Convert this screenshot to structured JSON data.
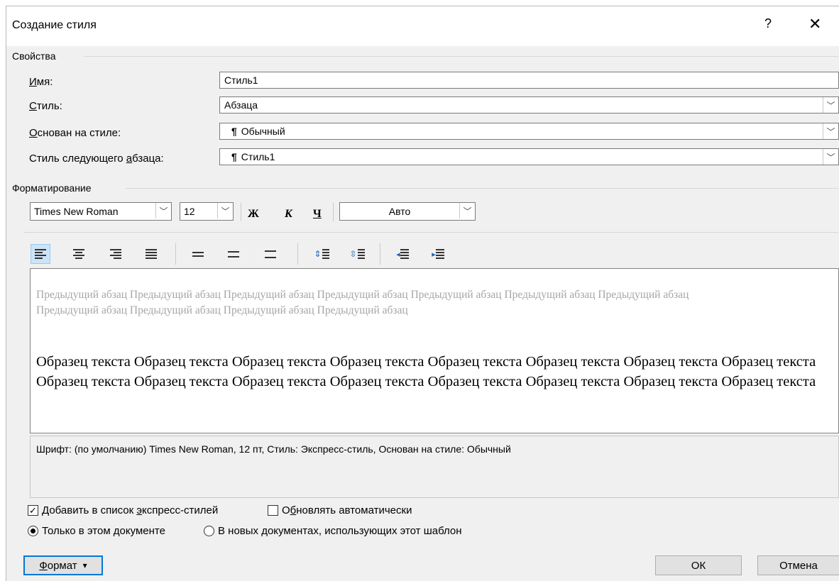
{
  "window": {
    "title": "Создание стиля",
    "help_label": "?",
    "close_label": "✕"
  },
  "properties": {
    "group_title": "Свойства",
    "name_label_u": "И",
    "name_label_rest": "мя:",
    "name_value": "Стиль1",
    "style_label_u": "С",
    "style_label_rest": "тиль:",
    "style_value": "Абзаца",
    "based_label_u": "О",
    "based_label_rest": "снован на стиле:",
    "based_value": "Обычный",
    "next_label_pre": "Стиль следующего ",
    "next_label_u": "а",
    "next_label_rest": "бзаца:",
    "next_value": "Стиль1"
  },
  "formatting": {
    "group_title": "Форматирование",
    "font_name": "Times New Roman",
    "font_size": "12",
    "bold_label": "Ж",
    "italic_label": "К",
    "underline_label": "Ч",
    "color_value": "Авто"
  },
  "preview": {
    "previous_paragraph": "Предыдущий абзац Предыдущий абзац Предыдущий абзац Предыдущий абзац Предыдущий абзац Предыдущий абзац Предыдущий абзац Предыдущий абзац Предыдущий абзац Предыдущий абзац Предыдущий абзац",
    "sample_text": "Образец текста Образец текста Образец текста Образец текста Образец текста Образец текста Образец текста Образец текста Образец текста Образец текста Образец текста Образец текста Образец текста Образец текста Образец текста Образец текста"
  },
  "description": "Шрифт: (по умолчанию) Times New Roman, 12 пт, Стиль: Экспресс-стиль, Основан на стиле: Обычный",
  "options": {
    "add_quick_pre": "Добавить в список ",
    "add_quick_u": "э",
    "add_quick_rest": "кспресс-стилей",
    "add_quick_checked": true,
    "auto_update_pre": "О",
    "auto_update_u": "б",
    "auto_update_rest": "новлять автоматически",
    "auto_update_checked": false,
    "only_doc": "Только в этом документе",
    "new_docs": "В новых документах, использующих этот шаблон"
  },
  "buttons": {
    "format_u": "Ф",
    "format_rest": "ормат",
    "format_arrow": "▾",
    "ok": "ОК",
    "cancel": "Отмена"
  }
}
